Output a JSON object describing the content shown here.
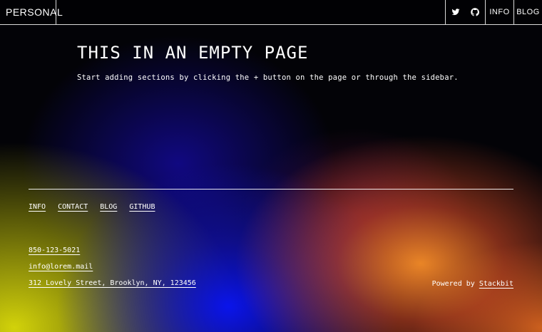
{
  "header": {
    "brand": "PERSONAL",
    "icons": [
      "twitter-icon",
      "github-icon"
    ],
    "nav": {
      "info": "INFO",
      "blog": "BLOG"
    }
  },
  "hero": {
    "title": "THIS IN AN EMPTY PAGE",
    "subtitle": "Start adding sections by clicking the + button on the page or through the sidebar."
  },
  "footer": {
    "nav": [
      "INFO",
      "CONTACT",
      "BLOG",
      "GITHUB"
    ],
    "phone": "850-123-5021",
    "email": "info@lorem.mail",
    "address": "312 Lovely Street, Brooklyn, NY, 123456",
    "powered_prefix": "Powered by",
    "powered_link": "Stackbit"
  }
}
